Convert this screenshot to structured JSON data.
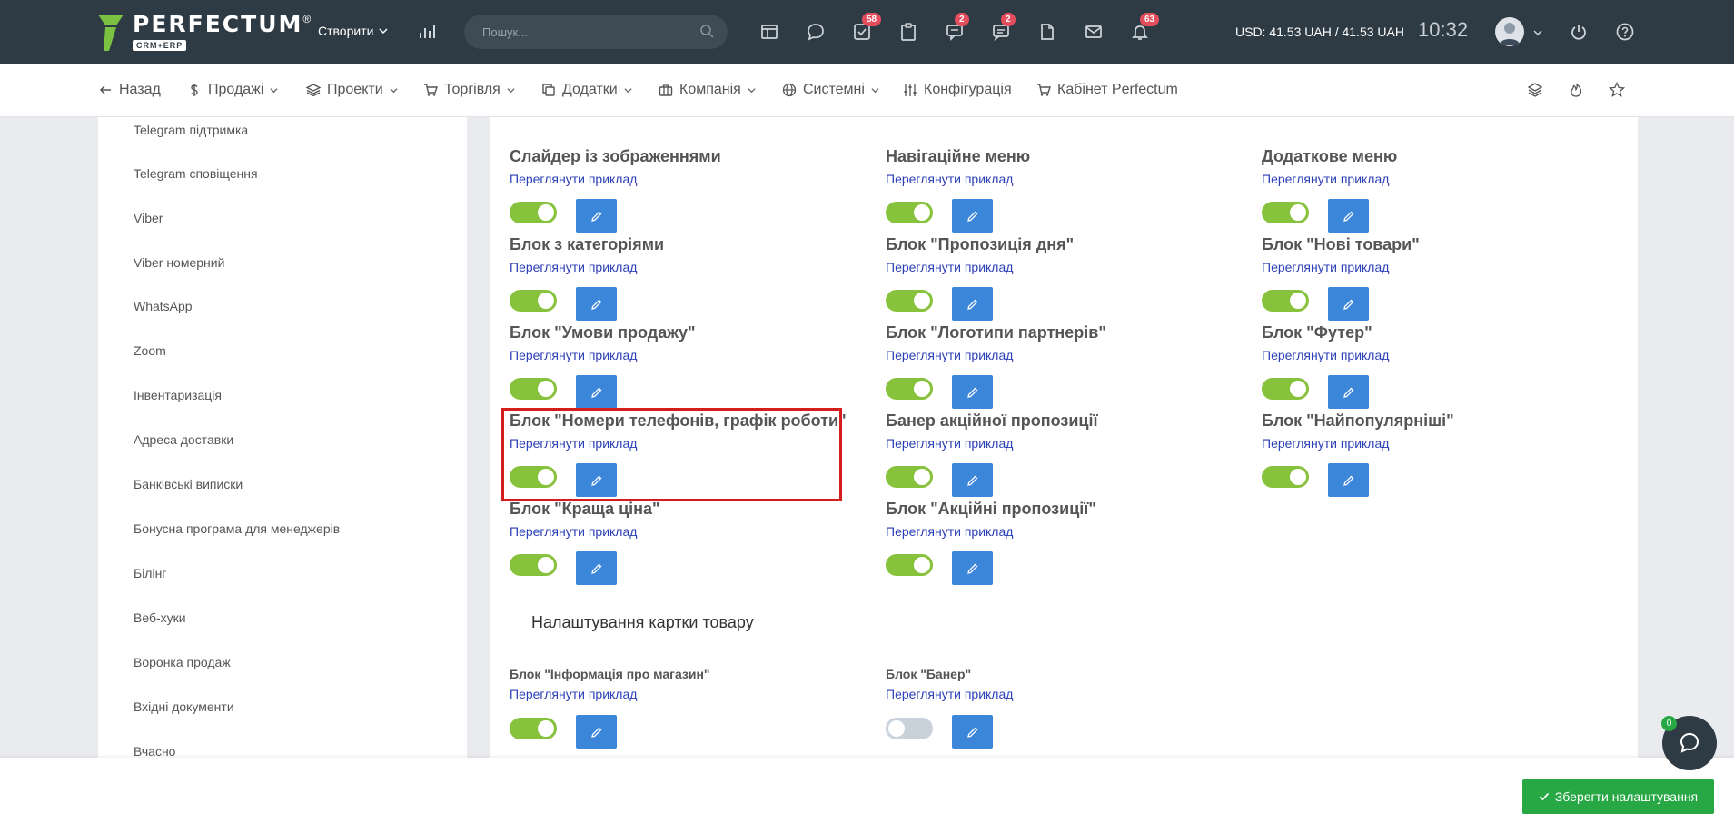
{
  "header": {
    "logo_text": "PERFECTUM",
    "logo_reg": "®",
    "logo_sub": "CRM+ERP",
    "create_label": "Створити",
    "search_placeholder": "Пошук...",
    "badges": {
      "tasks": "58",
      "chat": "2",
      "messages": "2",
      "notifications": "63"
    },
    "currency": "USD: 41.53 UAH / 41.53 UAH",
    "time": "10:32"
  },
  "nav": {
    "back": "Назад",
    "sales": "Продажі",
    "projects": "Проекти",
    "trade": "Торгівля",
    "addons": "Додатки",
    "company": "Компанія",
    "system": "Системні",
    "config": "Конфігурація",
    "cabinet": "Кабінет Perfectum"
  },
  "sidebar": {
    "items": [
      "Telegram підтримка",
      "Telegram сповіщення",
      "Viber",
      "Viber номерний",
      "WhatsApp",
      "Zoom",
      "Інвентаризація",
      "Адреса доставки",
      "Банківські виписки",
      "Бонусна програма для менеджерів",
      "Білінг",
      "Веб-хуки",
      "Воронка продаж",
      "Вхідні документи",
      "Вчасно"
    ]
  },
  "blocks": {
    "link_label": "Переглянути приклад",
    "items": [
      {
        "title": "Слайдер із зображеннями",
        "enabled": true
      },
      {
        "title": "Навігаційне меню",
        "enabled": true
      },
      {
        "title": "Додаткове меню",
        "enabled": true
      },
      {
        "title": "Блок з категоріями",
        "enabled": true
      },
      {
        "title": "Блок \"Пропозиція дня\"",
        "enabled": true
      },
      {
        "title": "Блок \"Нові товари\"",
        "enabled": true
      },
      {
        "title": "Блок \"Умови продажу\"",
        "enabled": true
      },
      {
        "title": "Блок \"Логотипи партнерів\"",
        "enabled": true
      },
      {
        "title": "Блок \"Футер\"",
        "enabled": true
      },
      {
        "title": "Блок \"Номери телефонів, графік роботи\"",
        "enabled": true
      },
      {
        "title": "Банер акційної пропозиції",
        "enabled": true
      },
      {
        "title": "Блок \"Найпопулярніші\"",
        "enabled": true
      },
      {
        "title": "Блок \"Краща ціна\"",
        "enabled": true
      },
      {
        "title": "Блок \"Акційні пропозиції\"",
        "enabled": true
      }
    ]
  },
  "product_card": {
    "section_title": "Налаштування картки товару",
    "items": [
      {
        "title": "Блок \"Інформація про магазин\"",
        "enabled": true
      },
      {
        "title": "Блок \"Банер\"",
        "enabled": false
      }
    ]
  },
  "footer": {
    "save_label": "Зберегти налаштування",
    "chat_badge": "0"
  },
  "colors": {
    "topbar": "#2f3b44",
    "toggle_on": "#86c23c",
    "edit_button": "#3b86d8",
    "save_button": "#28a745",
    "highlight": "#d41e1e",
    "badge": "#e44d5c"
  }
}
